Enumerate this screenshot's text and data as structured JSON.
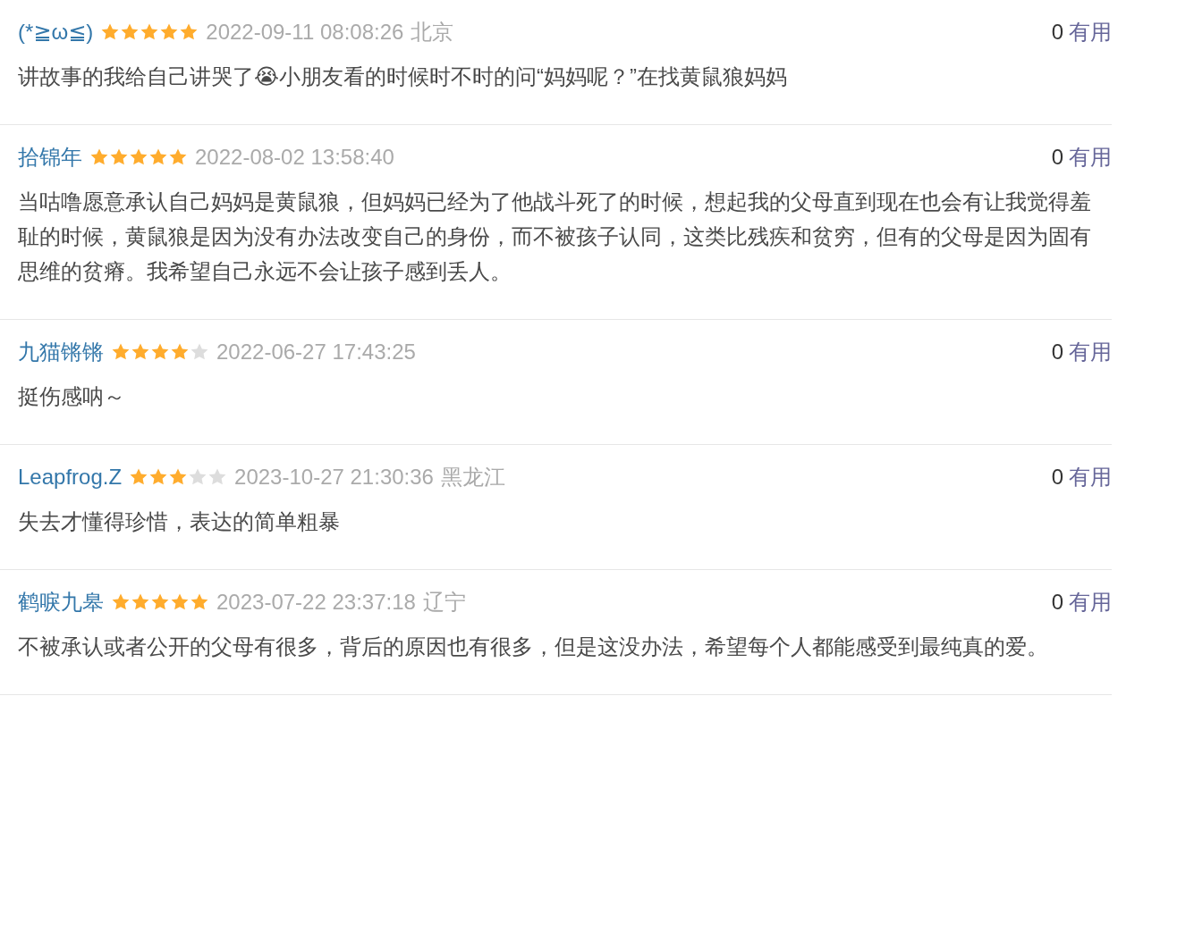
{
  "comments": [
    {
      "user": "(*≧ω≦)",
      "stars": 5,
      "time": "2022-09-11 08:08:26",
      "location": "北京",
      "votes": "0",
      "vote_label": "有用",
      "text": "讲故事的我给自己讲哭了😭小朋友看的时候时不时的问“妈妈呢？”在找黄鼠狼妈妈"
    },
    {
      "user": "拾锦年",
      "stars": 5,
      "time": "2022-08-02 13:58:40",
      "votes": "0",
      "vote_label": "有用",
      "text": "当咕噜愿意承认自己妈妈是黄鼠狼，但妈妈已经为了他战斗死了的时候，想起我的父母直到现在也会有让我觉得羞耻的时候，黄鼠狼是因为没有办法改变自己的身份，而不被孩子认同，这类比残疾和贫穷，但有的父母是因为固有思维的贫瘠。我希望自己永远不会让孩子感到丢人。"
    },
    {
      "user": "九猫锵锵",
      "stars": 4,
      "time": "2022-06-27 17:43:25",
      "votes": "0",
      "vote_label": "有用",
      "text": "挺伤感呐～"
    },
    {
      "user": "Leapfrog.Z",
      "stars": 3,
      "time": "2023-10-27 21:30:36",
      "location": "黑龙江",
      "votes": "0",
      "vote_label": "有用",
      "text": "失去才懂得珍惜，表达的简单粗暴"
    },
    {
      "user": "鹤唳九皋",
      "stars": 5,
      "time": "2023-07-22 23:37:18",
      "location": "辽宁",
      "votes": "0",
      "vote_label": "有用",
      "text": "不被承认或者公开的父母有很多，背后的原因也有很多，但是这没办法，希望每个人都能感受到最纯真的爱。"
    }
  ]
}
